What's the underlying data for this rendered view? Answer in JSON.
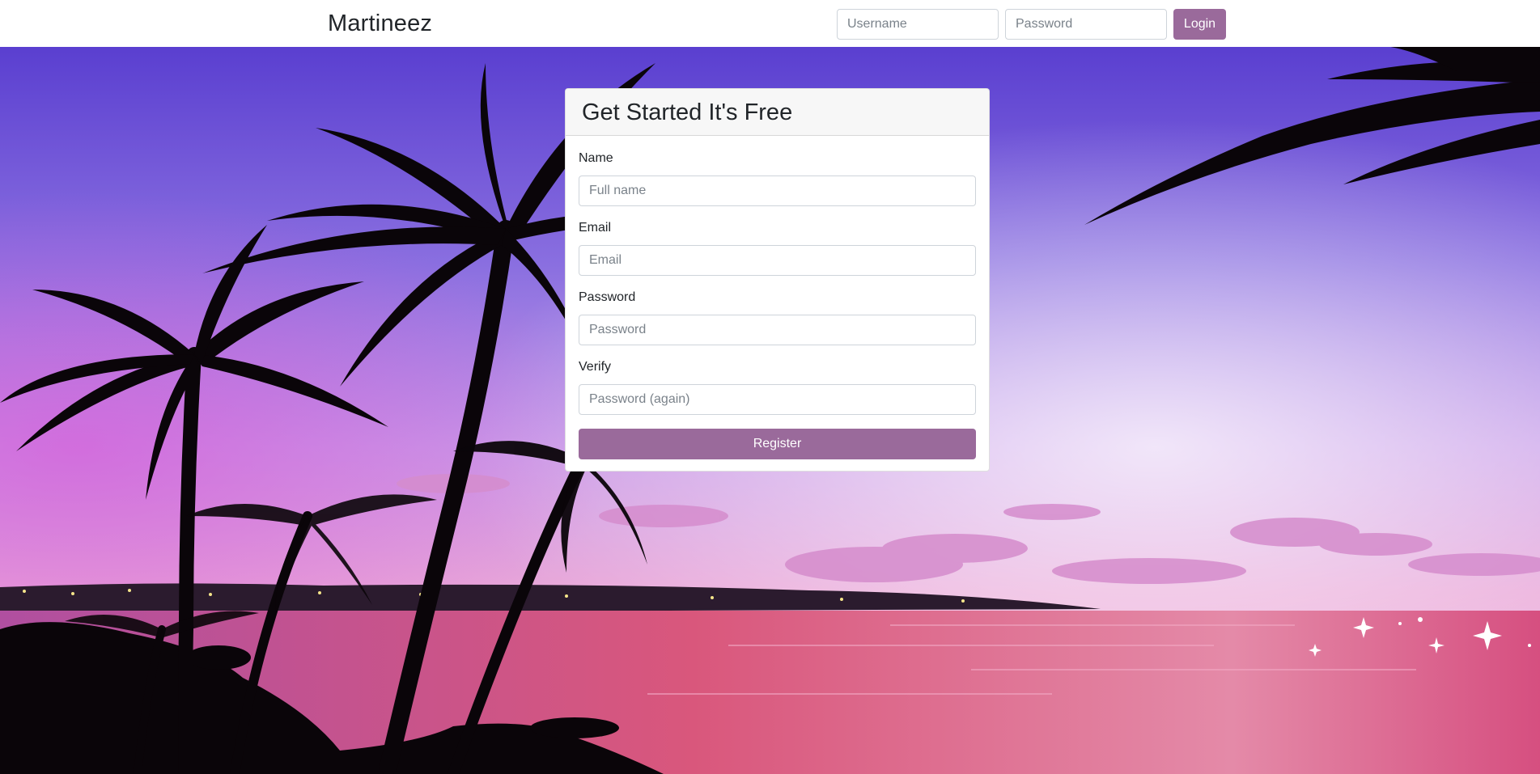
{
  "navbar": {
    "brand": "Martineez",
    "username_placeholder": "Username",
    "password_placeholder": "Password",
    "login_label": "Login"
  },
  "signup": {
    "title": "Get Started It's Free",
    "name_label": "Name",
    "name_placeholder": "Full name",
    "email_label": "Email",
    "email_placeholder": "Email",
    "password_label": "Password",
    "password_placeholder": "Password",
    "verify_label": "Verify",
    "verify_placeholder": "Password (again)",
    "register_label": "Register"
  },
  "colors": {
    "accent": "#9a6a9b",
    "sky_top": "#5a3fd0",
    "sky_bottom": "#f4c3e8",
    "sea": "#d1577f"
  },
  "background": {
    "scene": "tropical sunset beach with palm tree silhouettes"
  }
}
